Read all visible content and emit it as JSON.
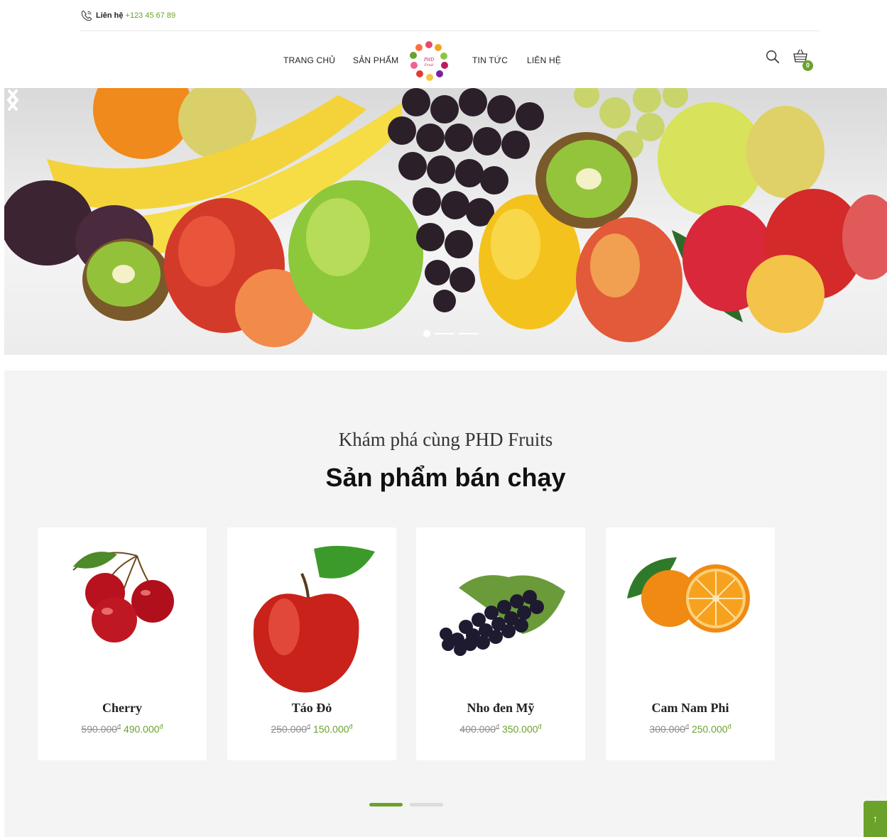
{
  "topbar": {
    "label": "Liên hệ",
    "phone": "+123 45 67 89"
  },
  "nav": {
    "items": [
      {
        "label": "TRANG CHỦ"
      },
      {
        "label": "SẢN PHẨM"
      },
      {
        "label": "TIN TỨC"
      },
      {
        "label": "LIÊN HỆ"
      }
    ],
    "cart_count": "0"
  },
  "hero": {
    "slides": 3,
    "active_slide": 1
  },
  "section": {
    "subtitle": "Khám phá cùng PHD Fruits",
    "title": "Sản phẩm bán chạy",
    "products": [
      {
        "name": "Cherry",
        "old_price": "590.000",
        "new_price": "490.000",
        "currency": "đ"
      },
      {
        "name": "Táo Đỏ",
        "old_price": "250.000",
        "new_price": "150.000",
        "currency": "đ"
      },
      {
        "name": "Nho đen Mỹ",
        "old_price": "400.000",
        "new_price": "350.000",
        "currency": "đ"
      },
      {
        "name": "Cam Nam Phi",
        "old_price": "300.000",
        "new_price": "250.000",
        "currency": "đ"
      }
    ],
    "pages": 2,
    "active_page": 1
  },
  "colors": {
    "accent": "#6aa22b",
    "section_bg": "#f4f4f4"
  },
  "back_to_top": {
    "symbol": "↑"
  }
}
